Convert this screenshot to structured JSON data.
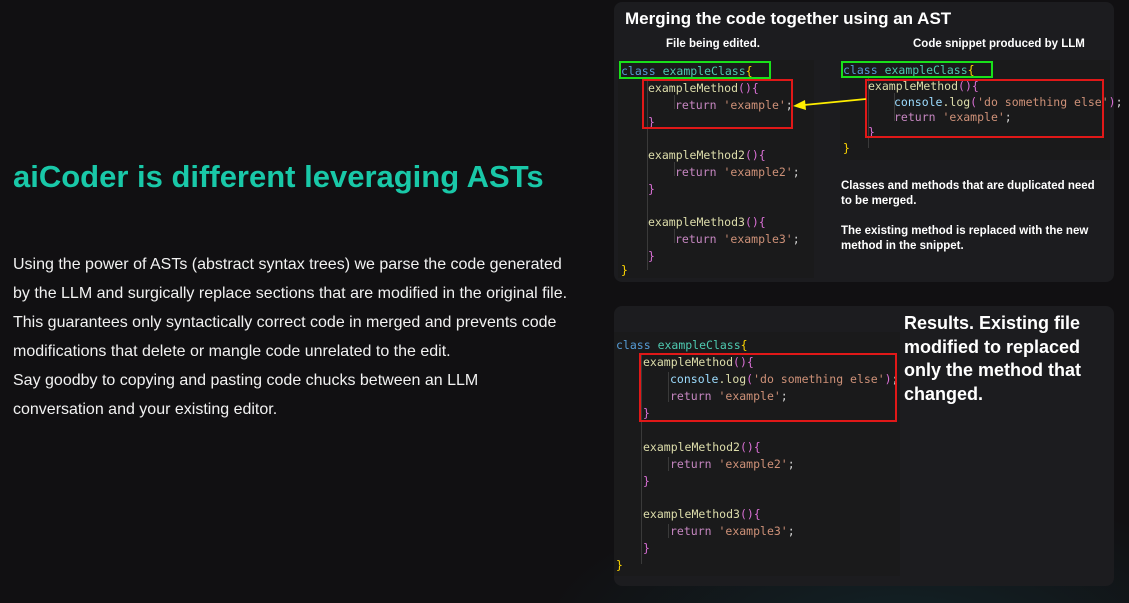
{
  "hero": {
    "title": "aiCoder is different leveraging ASTs",
    "paragraphs": [
      "Using the power of ASTs (abstract syntax trees) we parse the code generated by the LLM and surgically replace sections that are modified in the original file.",
      "This guarantees only syntactically correct code in merged and prevents code modifications that delete or mangle code unrelated to the edit.",
      "Say goodby to copying and pasting code chucks between an LLM conversation and your existing editor."
    ]
  },
  "merge_panel": {
    "title": "Merging the code together using an AST",
    "left_label": "File being edited.",
    "right_label": "Code snippet produced by LLM",
    "note1": "Classes and methods that are duplicated need to be merged.",
    "note2": "The existing method is replaced with the new method in the snippet."
  },
  "result_panel": {
    "text": "Results. Existing file modified to replaced only the method that changed."
  },
  "code": {
    "kw_class": "class",
    "class_name": "exampleClass",
    "open_brace": "{",
    "close_brace": "}",
    "method1": "exampleMethod",
    "method2": "exampleMethod2",
    "method3": "exampleMethod3",
    "parens": "()",
    "kw_return": "return",
    "str1": "'example'",
    "str2": "'example2'",
    "str3": "'example3'",
    "console": "console",
    "log": ".log",
    "log_arg": "'do something else'",
    "semicolon": ";",
    "open_paren": "(",
    "close_paren": ")"
  },
  "colors": {
    "accent": "#19c8a8",
    "highlight_green": "#19e01a",
    "highlight_red": "#e01818",
    "arrow": "#ffee00"
  }
}
